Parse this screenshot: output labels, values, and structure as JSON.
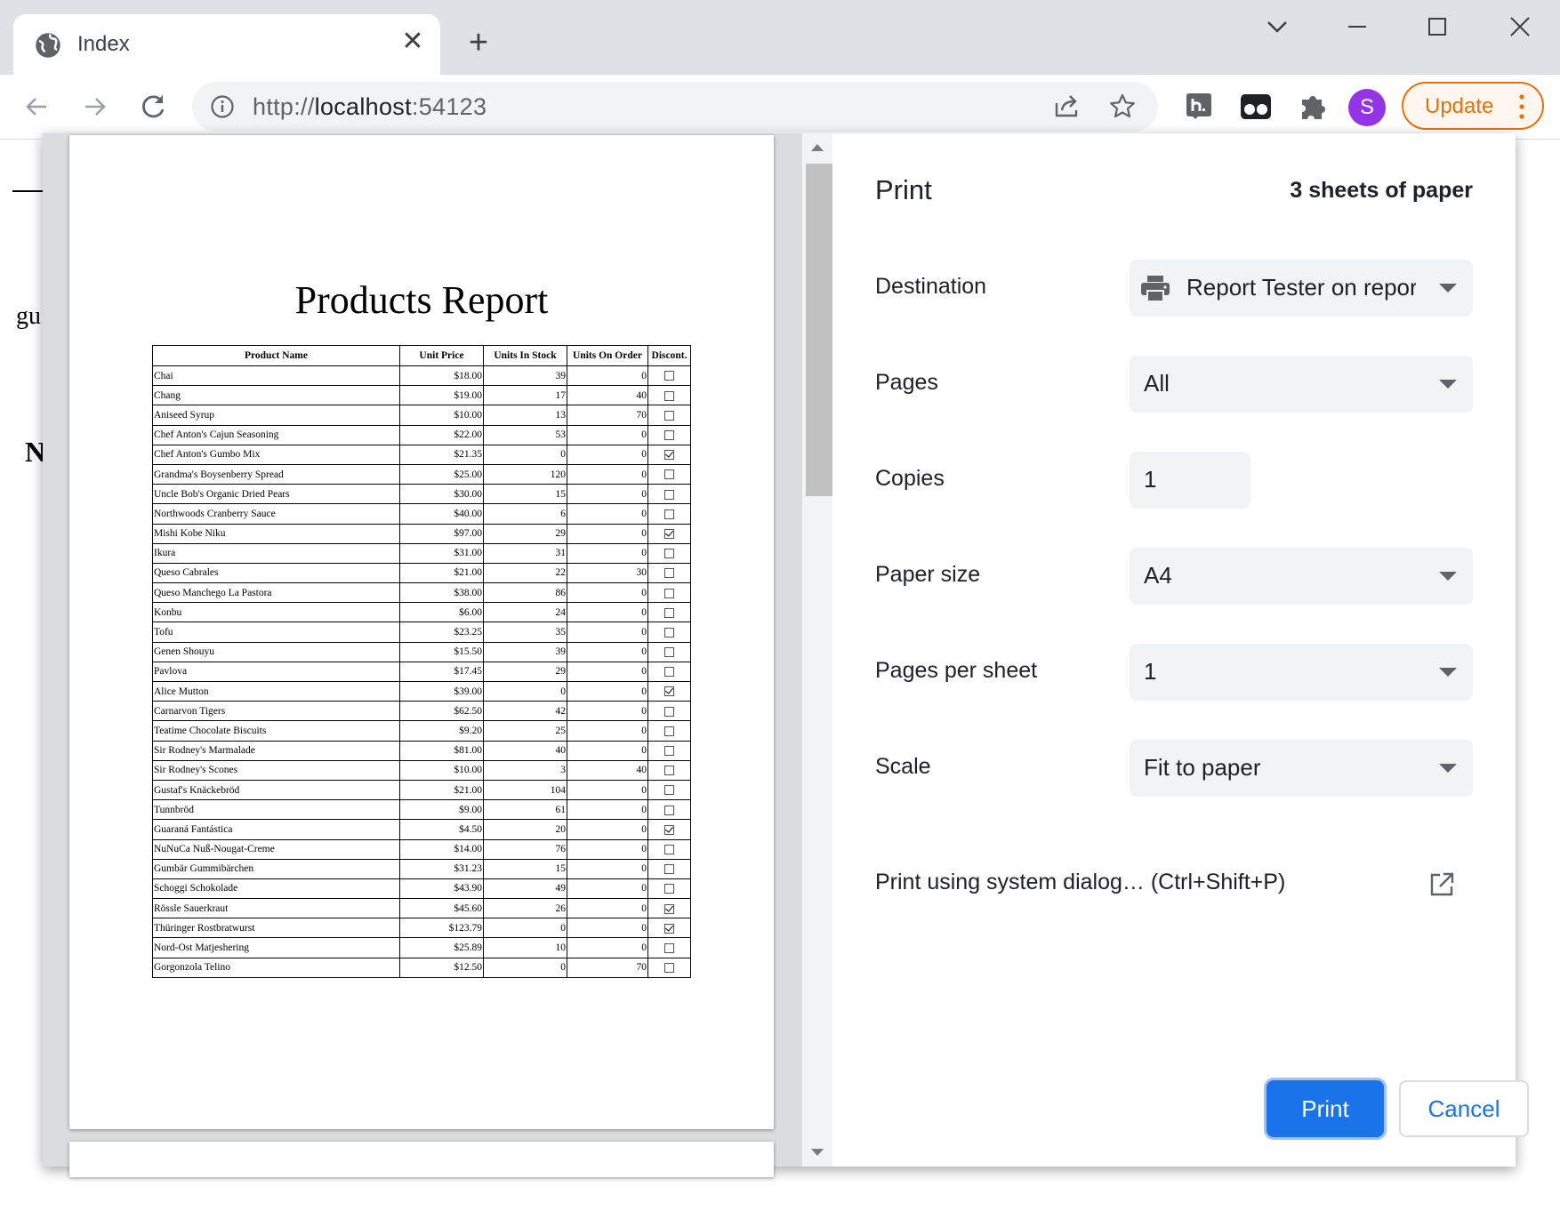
{
  "browser": {
    "tab_title": "Index",
    "url_scheme": "http://",
    "url_host": "localhost",
    "url_port": ":54123",
    "update_label": "Update",
    "avatar_letter": "S",
    "avatar_color": "#9334e6",
    "accent_update": "#e8710a"
  },
  "background_page": {
    "frag1": "gu",
    "frag2": "N"
  },
  "print_dialog": {
    "title": "Print",
    "sheets": "3 sheets of paper",
    "destination_label": "Destination",
    "destination_value": "Report Tester on repor",
    "pages_label": "Pages",
    "pages_value": "All",
    "copies_label": "Copies",
    "copies_value": "1",
    "paper_size_label": "Paper size",
    "paper_size_value": "A4",
    "pages_per_sheet_label": "Pages per sheet",
    "pages_per_sheet_value": "1",
    "scale_label": "Scale",
    "scale_value": "Fit to paper",
    "system_dialog_label": "Print using system dialog… (Ctrl+Shift+P)",
    "print_button": "Print",
    "cancel_button": "Cancel",
    "primary_color": "#1a73e8"
  },
  "report": {
    "title": "Products Report",
    "columns": [
      "Product Name",
      "Unit Price",
      "Units In Stock",
      "Units On Order",
      "Discont."
    ],
    "rows": [
      {
        "name": "Chai",
        "price": "$18.00",
        "stock": "39",
        "order": "0",
        "disc": false
      },
      {
        "name": "Chang",
        "price": "$19.00",
        "stock": "17",
        "order": "40",
        "disc": false
      },
      {
        "name": "Aniseed Syrup",
        "price": "$10.00",
        "stock": "13",
        "order": "70",
        "disc": false
      },
      {
        "name": "Chef Anton's Cajun Seasoning",
        "price": "$22.00",
        "stock": "53",
        "order": "0",
        "disc": false
      },
      {
        "name": "Chef Anton's Gumbo Mix",
        "price": "$21.35",
        "stock": "0",
        "order": "0",
        "disc": true
      },
      {
        "name": "Grandma's Boysenberry Spread",
        "price": "$25.00",
        "stock": "120",
        "order": "0",
        "disc": false
      },
      {
        "name": "Uncle Bob's Organic Dried Pears",
        "price": "$30.00",
        "stock": "15",
        "order": "0",
        "disc": false
      },
      {
        "name": "Northwoods Cranberry Sauce",
        "price": "$40.00",
        "stock": "6",
        "order": "0",
        "disc": false
      },
      {
        "name": "Mishi Kobe Niku",
        "price": "$97.00",
        "stock": "29",
        "order": "0",
        "disc": true
      },
      {
        "name": "Ikura",
        "price": "$31.00",
        "stock": "31",
        "order": "0",
        "disc": false
      },
      {
        "name": "Queso Cabrales",
        "price": "$21.00",
        "stock": "22",
        "order": "30",
        "disc": false
      },
      {
        "name": "Queso Manchego La Pastora",
        "price": "$38.00",
        "stock": "86",
        "order": "0",
        "disc": false
      },
      {
        "name": "Konbu",
        "price": "$6.00",
        "stock": "24",
        "order": "0",
        "disc": false
      },
      {
        "name": "Tofu",
        "price": "$23.25",
        "stock": "35",
        "order": "0",
        "disc": false
      },
      {
        "name": "Genen Shouyu",
        "price": "$15.50",
        "stock": "39",
        "order": "0",
        "disc": false
      },
      {
        "name": "Pavlova",
        "price": "$17.45",
        "stock": "29",
        "order": "0",
        "disc": false
      },
      {
        "name": "Alice Mutton",
        "price": "$39.00",
        "stock": "0",
        "order": "0",
        "disc": true
      },
      {
        "name": "Carnarvon Tigers",
        "price": "$62.50",
        "stock": "42",
        "order": "0",
        "disc": false
      },
      {
        "name": "Teatime Chocolate Biscuits",
        "price": "$9.20",
        "stock": "25",
        "order": "0",
        "disc": false
      },
      {
        "name": "Sir Rodney's Marmalade",
        "price": "$81.00",
        "stock": "40",
        "order": "0",
        "disc": false
      },
      {
        "name": "Sir Rodney's Scones",
        "price": "$10.00",
        "stock": "3",
        "order": "40",
        "disc": false
      },
      {
        "name": "Gustaf's Knäckebröd",
        "price": "$21.00",
        "stock": "104",
        "order": "0",
        "disc": false
      },
      {
        "name": "Tunnbröd",
        "price": "$9.00",
        "stock": "61",
        "order": "0",
        "disc": false
      },
      {
        "name": "Guaraná Fantástica",
        "price": "$4.50",
        "stock": "20",
        "order": "0",
        "disc": true
      },
      {
        "name": "NuNuCa Nuß-Nougat-Creme",
        "price": "$14.00",
        "stock": "76",
        "order": "0",
        "disc": false
      },
      {
        "name": "Gumbär Gummibärchen",
        "price": "$31.23",
        "stock": "15",
        "order": "0",
        "disc": false
      },
      {
        "name": "Schoggi Schokolade",
        "price": "$43.90",
        "stock": "49",
        "order": "0",
        "disc": false
      },
      {
        "name": "Rössle Sauerkraut",
        "price": "$45.60",
        "stock": "26",
        "order": "0",
        "disc": true
      },
      {
        "name": "Thüringer Rostbratwurst",
        "price": "$123.79",
        "stock": "0",
        "order": "0",
        "disc": true
      },
      {
        "name": "Nord-Ost Matjeshering",
        "price": "$25.89",
        "stock": "10",
        "order": "0",
        "disc": false
      },
      {
        "name": "Gorgonzola Telino",
        "price": "$12.50",
        "stock": "0",
        "order": "70",
        "disc": false
      }
    ]
  }
}
